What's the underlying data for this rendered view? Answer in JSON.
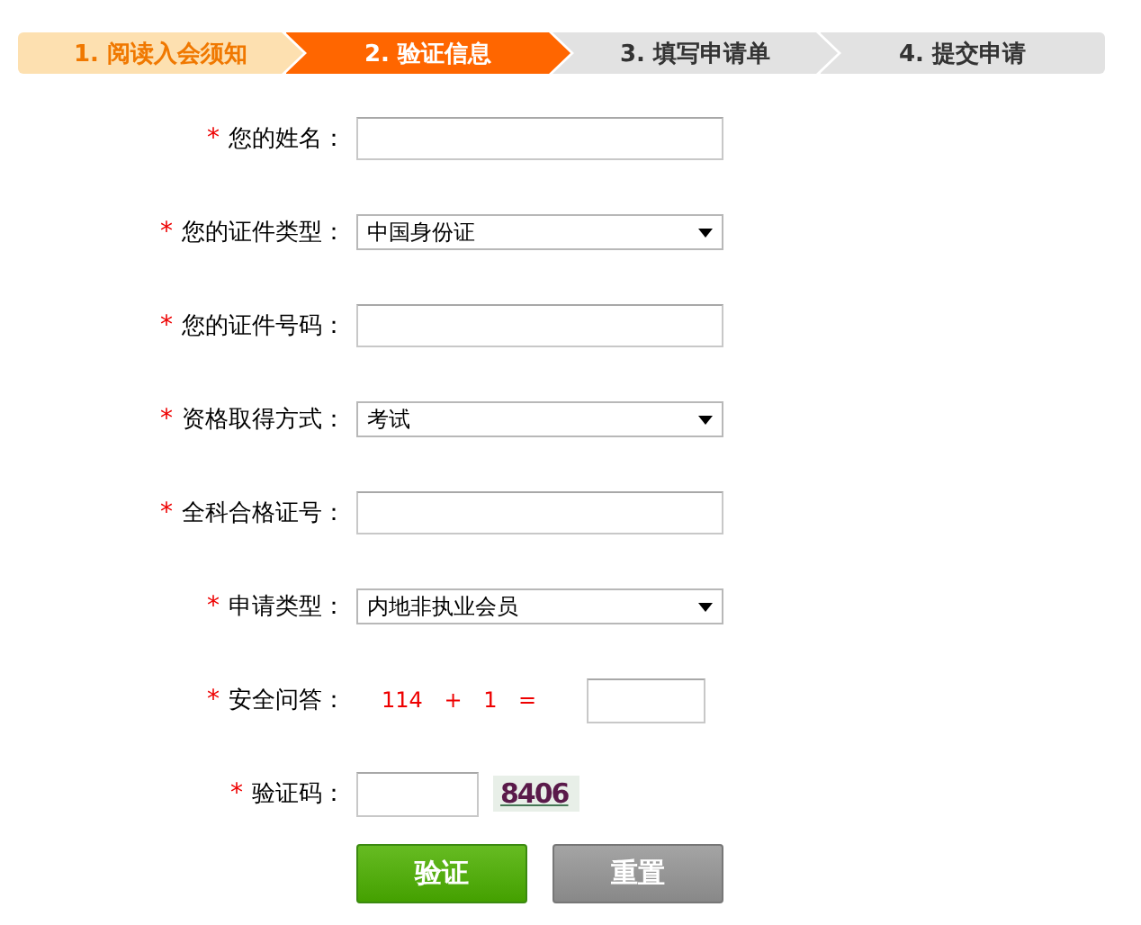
{
  "steps": [
    {
      "label": "1. 阅读入会须知",
      "completed": true,
      "selected": false
    },
    {
      "label": "2. 验证信息",
      "completed": false,
      "selected": true
    },
    {
      "label": "3. 填写申请单",
      "completed": false,
      "selected": false
    },
    {
      "label": "4. 提交申请",
      "completed": false,
      "selected": false
    }
  ],
  "fields": [
    {
      "kind": "text",
      "required": true,
      "label": "您的姓名："
    },
    {
      "kind": "select",
      "required": true,
      "label": "您的证件类型：",
      "value": "中国身份证"
    },
    {
      "kind": "text",
      "required": true,
      "label": "您的证件号码："
    },
    {
      "kind": "select",
      "required": true,
      "label": "资格取得方式：",
      "value": "考试"
    },
    {
      "kind": "text",
      "required": true,
      "label": "全科合格证号："
    },
    {
      "kind": "select",
      "required": true,
      "label": "申请类型：",
      "value": "内地非执业会员"
    },
    {
      "kind": "question",
      "required": true,
      "label": "安全问答：",
      "question": "114 + 1 ="
    },
    {
      "kind": "captcha",
      "required": true,
      "label": "验证码：",
      "code": "8406"
    }
  ],
  "required_mark": "*",
  "buttons": [
    {
      "label": "验证",
      "kind": "primary"
    },
    {
      "label": "重置",
      "kind": "secondary"
    }
  ]
}
